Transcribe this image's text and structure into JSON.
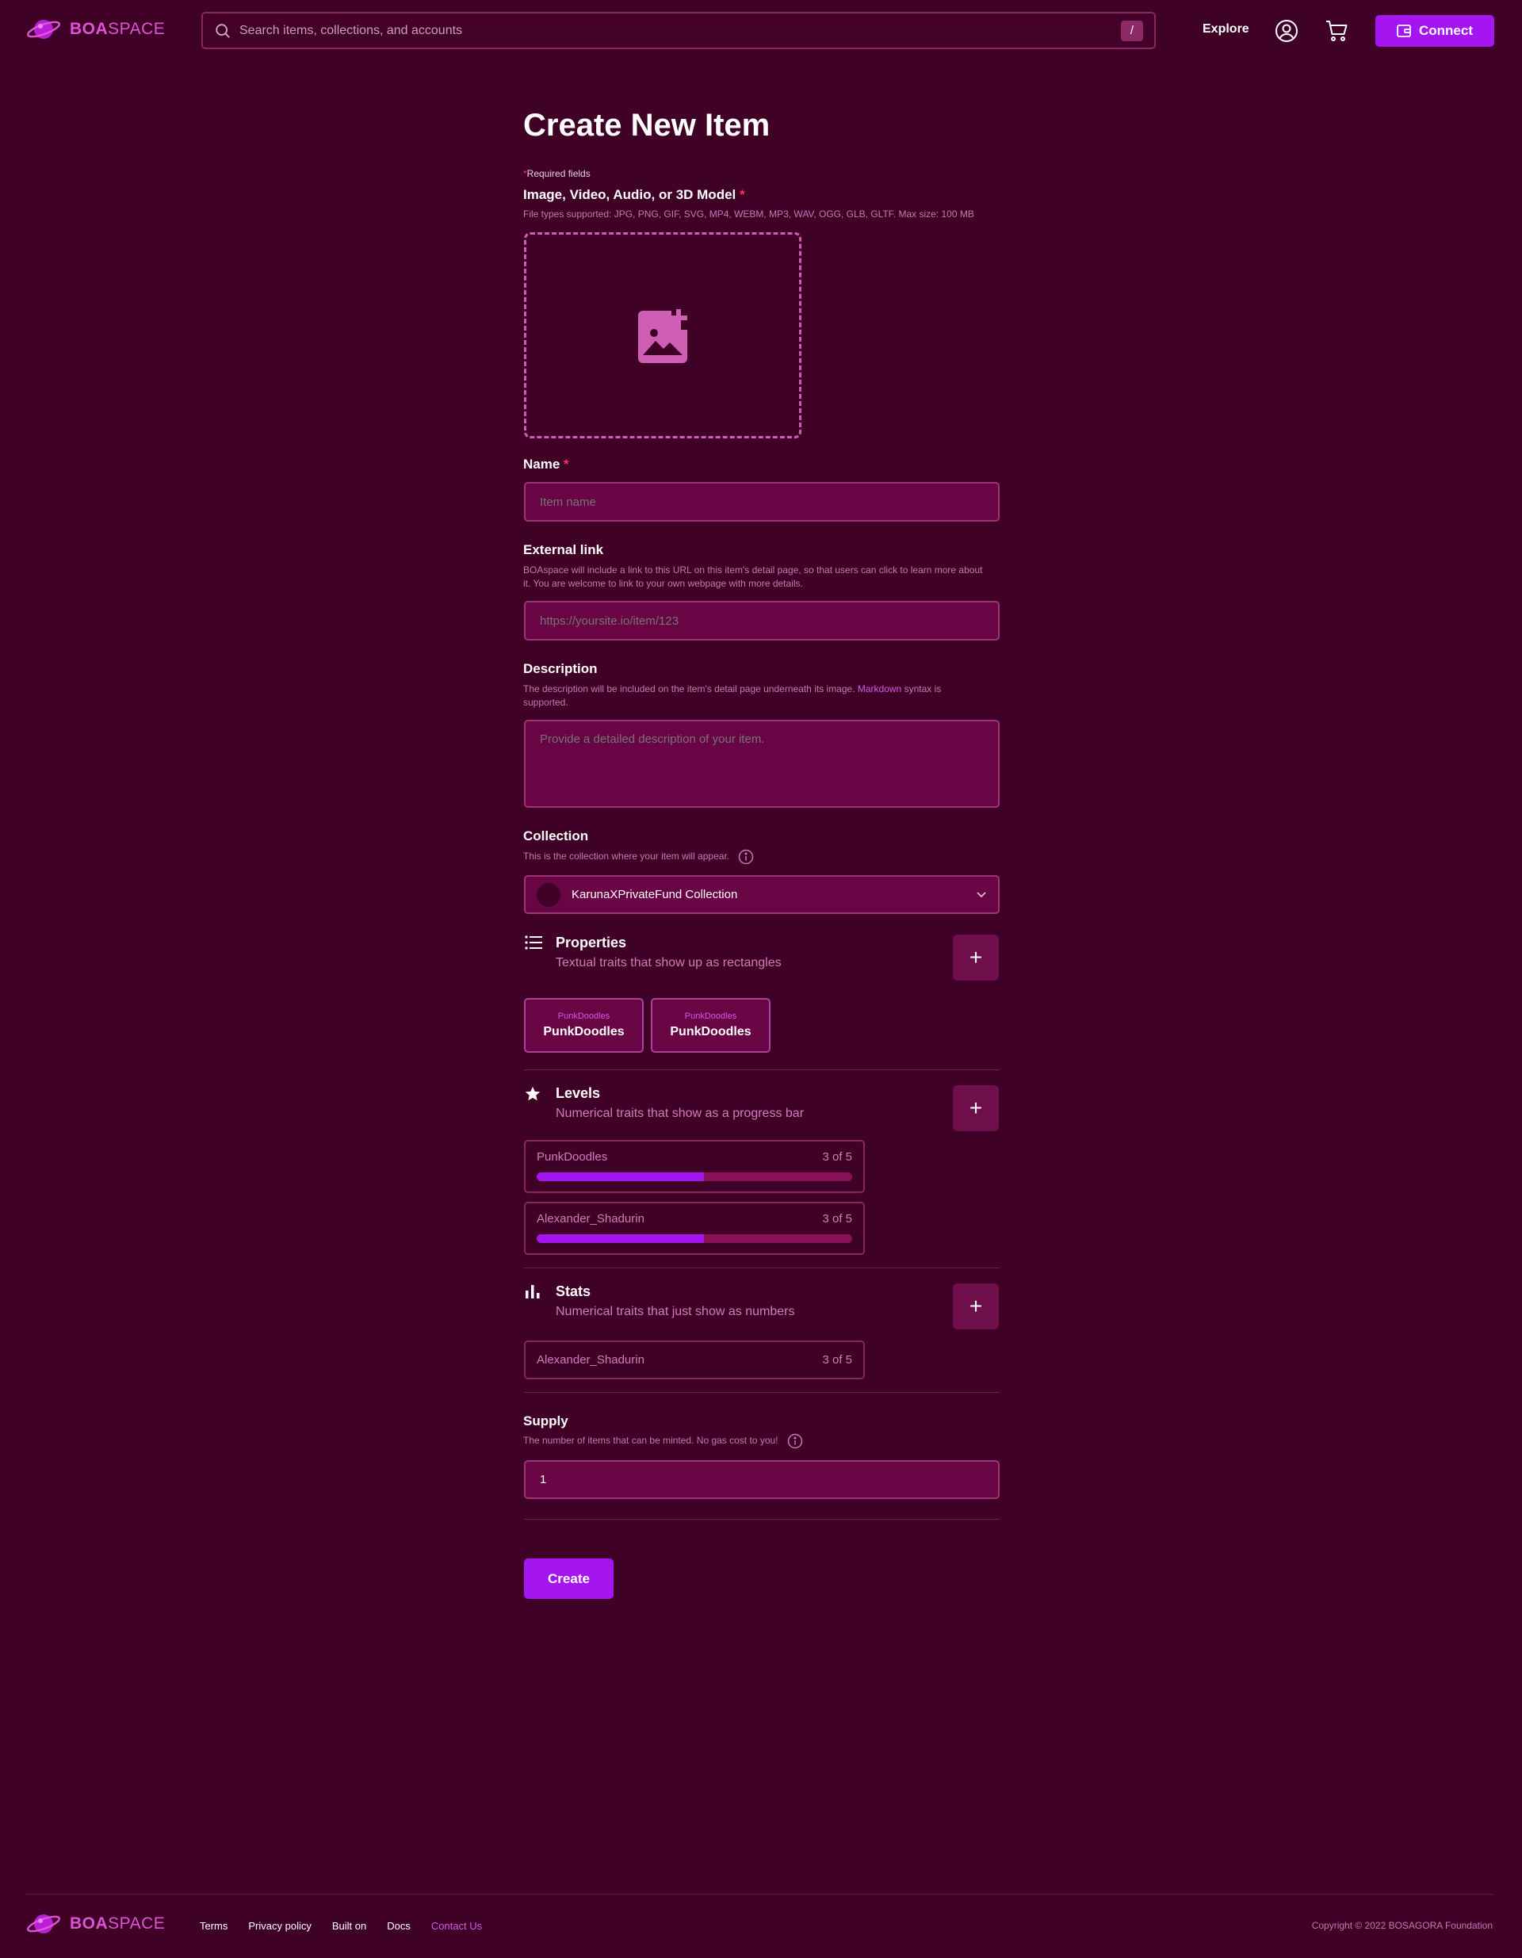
{
  "header": {
    "logo_bold": "BOA",
    "logo_light": "SPACE",
    "search_placeholder": "Search items, collections, and accounts",
    "search_shortcut": "/",
    "explore_label": "Explore",
    "connect_label": "Connect",
    "icons": [
      "planet-logo-icon",
      "search-icon",
      "user-icon",
      "cart-icon",
      "wallet-icon"
    ]
  },
  "form": {
    "title": "Create New Item",
    "required_star": "*",
    "required_note": "Required fields",
    "media": {
      "label": "Image, Video, Audio, or 3D Model",
      "helper": "File types supported: JPG, PNG, GIF, SVG, MP4, WEBM, MP3, WAV, OGG, GLB, GLTF. Max size: 100 MB",
      "icon": "add-image-icon"
    },
    "name": {
      "label": "Name",
      "placeholder": "Item name"
    },
    "external_link": {
      "label": "External link",
      "helper": "BOAspace will include a link to this URL on this item's detail page, so that users can click to learn more about it. You are welcome to link to your own webpage with more details.",
      "placeholder": "https://yoursite.io/item/123"
    },
    "description": {
      "label": "Description",
      "helper_prefix": "The description will be included on the item's detail page underneath its image. ",
      "helper_link": "Markdown",
      "helper_suffix": " syntax is supported.",
      "placeholder": "Provide a detailed description of your item."
    },
    "collection": {
      "label": "Collection",
      "helper": "This is the collection where your item will appear.",
      "selected": "KarunaXPrivateFund Collection"
    },
    "properties": {
      "title": "Properties",
      "subtitle": "Textual traits that show up as rectangles",
      "items": [
        {
          "type": "PunkDoodles",
          "value": "PunkDoodles"
        },
        {
          "type": "PunkDoodles",
          "value": "PunkDoodles"
        }
      ]
    },
    "levels": {
      "title": "Levels",
      "subtitle": "Numerical traits that show as a progress bar",
      "items": [
        {
          "name": "PunkDoodles",
          "value_text": "3 of 5",
          "progress": 0.53
        },
        {
          "name": "Alexander_Shadurin",
          "value_text": "3 of 5",
          "progress": 0.53
        }
      ]
    },
    "stats": {
      "title": "Stats",
      "subtitle": "Numerical traits that just show as numbers",
      "items": [
        {
          "name": "Alexander_Shadurin",
          "value_text": "3 of 5"
        }
      ]
    },
    "supply": {
      "label": "Supply",
      "helper": "The number of items that can be minted. No gas cost to you!",
      "value": "1"
    },
    "plus": "+",
    "create_label": "Create"
  },
  "footer": {
    "logo_bold": "BOA",
    "logo_light": "SPACE",
    "links": [
      "Terms",
      "Privacy policy",
      "Built on",
      "Docs",
      "Contact Us"
    ],
    "copyright": "Copyright © 2022 BOSAGORA Foundation"
  },
  "colors": {
    "background": "#3f0126",
    "accent": "#a415f0",
    "input_bg": "#690445",
    "pink": "#d17cb9",
    "required": "#ff2f5f"
  }
}
